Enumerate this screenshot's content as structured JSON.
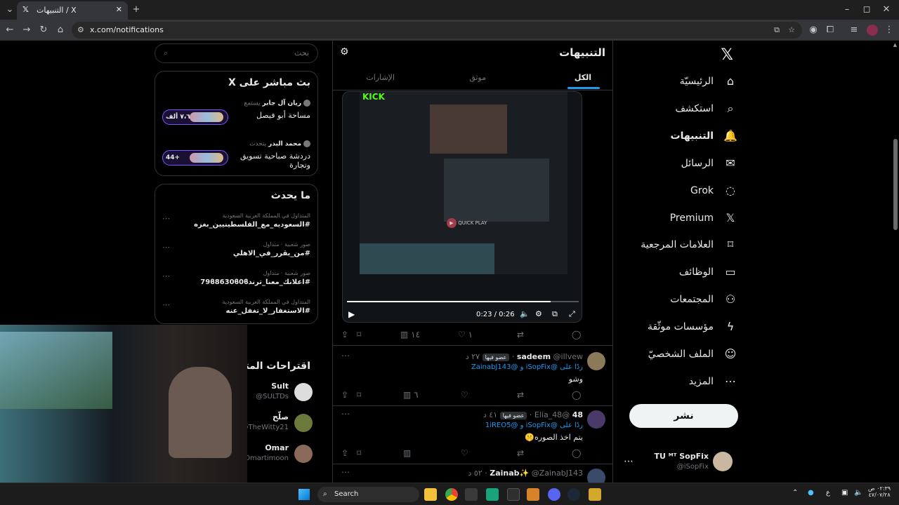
{
  "browser": {
    "tab_title": "X / التنبيهات",
    "url": "x.com/notifications",
    "window_controls": [
      "–",
      "◻",
      "✕"
    ]
  },
  "nav": {
    "items": [
      {
        "label": "الرئيسيّة",
        "icon": "home-icon",
        "glyph": "⌂"
      },
      {
        "label": "استكشف",
        "icon": "search-icon",
        "glyph": "⌕"
      },
      {
        "label": "التنبيهات",
        "icon": "bell-icon",
        "glyph": "🔔"
      },
      {
        "label": "الرسائل",
        "icon": "mail-icon",
        "glyph": "✉"
      },
      {
        "label": "Grok",
        "icon": "grok-icon",
        "glyph": "◌"
      },
      {
        "label": "Premium",
        "icon": "x-logo-icon",
        "glyph": "𝕏"
      },
      {
        "label": "العلامات المرجعية",
        "icon": "bookmark-icon",
        "glyph": "⌑"
      },
      {
        "label": "الوظائف",
        "icon": "briefcase-icon",
        "glyph": "▭"
      },
      {
        "label": "المجتمعات",
        "icon": "people-icon",
        "glyph": "⚇"
      },
      {
        "label": "مؤسسات موثّقة",
        "icon": "lightning-icon",
        "glyph": "ϟ"
      },
      {
        "label": "الملف الشخصيّ",
        "icon": "person-icon",
        "glyph": "☺"
      },
      {
        "label": "المزيد",
        "icon": "more-circle-icon",
        "glyph": "⋯"
      }
    ],
    "post_button": "نشر",
    "account": {
      "name": "TU ᴹᵀ SopFix",
      "handle": "@iSopFix"
    }
  },
  "main": {
    "title": "التنبيهات",
    "tabs": [
      "الكل",
      "موثق",
      "الإشارات"
    ],
    "video": {
      "time": "0:23 / 0:26",
      "quick_play": "QUICK PLAY",
      "brand": "KICK"
    },
    "tweet0_actions": {
      "views": "١٤",
      "likes": "١"
    },
    "tweets": [
      {
        "name": "sadeem",
        "handle": "@illvew",
        "time": "٢٧ د",
        "badge": "عضو فيها",
        "reply_to": "ردًا على @iSopFix و @ZainabJ143",
        "text": "وشو",
        "views": "٦"
      },
      {
        "name": "48",
        "handle": "@Elia_48",
        "time": "٤١ د",
        "badge": "عضو فيها",
        "reply_to": "ردًا على @iSopFix و @1iREO5",
        "text": "يتم اخذ الصوره🤫",
        "views": ""
      },
      {
        "name": "Zainab✨",
        "handle": "@ZainabJ143",
        "time": "٥٢ د",
        "badge": "",
        "reply_to": "",
        "text": "",
        "views": ""
      }
    ]
  },
  "sidebar": {
    "search_placeholder": "بحث",
    "live": {
      "title": "بث مباشر على X",
      "spaces": [
        {
          "host_label": "يستمع",
          "host": "ريان آل جابر",
          "title": "مساحة أبو فيصل",
          "count": "٧،٦ ألف+"
        },
        {
          "host_label": "يتحدث",
          "host": "محمد البدر",
          "title": "دردشة صباحية تسويق وتجارة",
          "count": "44+"
        }
      ]
    },
    "trends": {
      "title": "ما يحدث",
      "items": [
        {
          "meta": "المتداول في المملكة العربية السعودية",
          "tag": "#السعوديه_مع_الفلسطينيين_بغزه"
        },
        {
          "meta": "صور شعبية · متداول",
          "tag": "#من_يقرر_في_الاهلي"
        },
        {
          "meta": "صور شعبية · متداول",
          "tag": "#اعلانك_معنا_ترند79ϐ8630ϐ0ϐ"
        },
        {
          "meta": "المتداول في المملكة العربية السعودية",
          "tag": "#الاستغفار_لا_تغفل_عنه"
        }
      ]
    },
    "follow": {
      "title": "اقتراحات المتابعة",
      "users": [
        {
          "name": "Sult",
          "handle": "@SULTDs"
        },
        {
          "name": "صلّح",
          "handle": "@TheWitty21"
        },
        {
          "name": "Omar",
          "handle": "@Omartimoon"
        }
      ]
    }
  },
  "taskbar": {
    "search": "Search",
    "clock_time": "٠٢:٣٩ ص",
    "clock_date": "٤٧/٠٧/٢٨",
    "lang": "ع"
  },
  "colors": {
    "accent": "#1d9bf0",
    "bg": "#000000",
    "border": "#2f3336",
    "muted": "#71767b"
  }
}
